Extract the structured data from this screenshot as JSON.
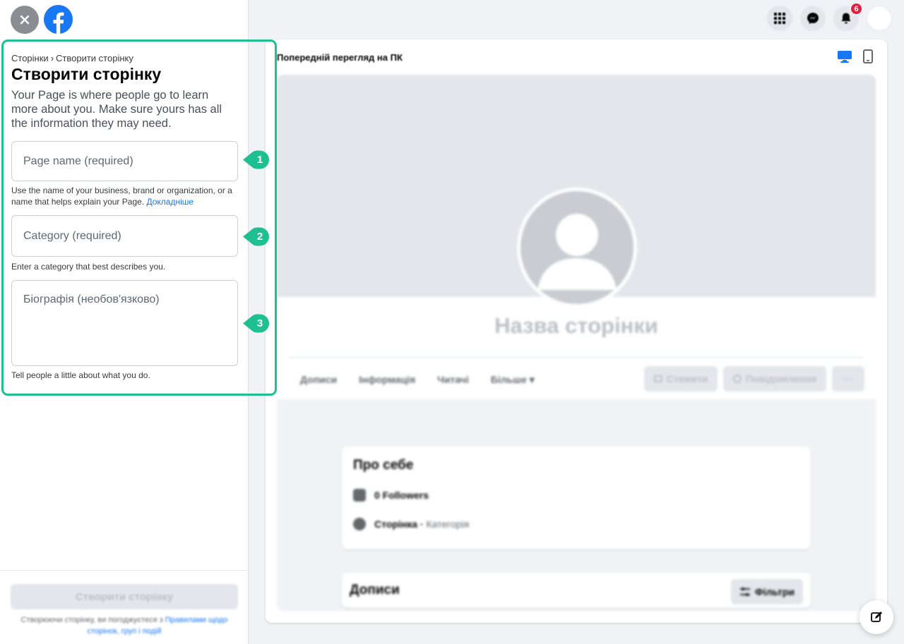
{
  "header": {
    "close_icon": "close-icon",
    "logo_icon": "facebook-logo-icon"
  },
  "breadcrumb": {
    "parent": "Сторінки",
    "separator": "›",
    "current": "Створити сторінку"
  },
  "form": {
    "title": "Створити сторінку",
    "intro": "Your Page is where people go to learn more about you. Make sure yours has all the information they may need.",
    "page_name": {
      "placeholder": "Page name (required)",
      "value": "",
      "hint": "Use the name of your business, brand or organization, or a name that helps explain your Page.",
      "hint_link": "Докладніше"
    },
    "category": {
      "placeholder": "Category (required)",
      "value": "",
      "hint": "Enter a category that best describes you."
    },
    "bio": {
      "placeholder": "Біографія (необов'язково)",
      "value": "",
      "hint": "Tell people a little about what you do."
    },
    "markers": [
      "1",
      "2",
      "3"
    ]
  },
  "footer": {
    "create_button": "Створити сторінку",
    "terms_text": "Створюючи сторінку, ви погоджуєтеся з",
    "terms_link": "Правилами щодо сторінок, груп і подій"
  },
  "topbar": {
    "notifications_badge": "6",
    "icons": [
      "menu-grid-icon",
      "messenger-icon",
      "notifications-icon",
      "account-icon"
    ]
  },
  "preview": {
    "title": "Попередній перегляд на ПК",
    "device_icons": [
      "desktop-icon",
      "mobile-icon"
    ],
    "page_name_placeholder": "Назва сторінки",
    "tabs": [
      "Дописи",
      "Інформація",
      "Читачі",
      "Більше"
    ],
    "more_caret": "▾",
    "follow_button": "Стежити",
    "message_button": "Повідомлення",
    "more_button": "···",
    "about": {
      "title": "Про себе",
      "followers": "0 Followers",
      "page_label": "Сторінка",
      "category_label": "Категорія"
    },
    "posts": {
      "title": "Дописи",
      "filters_button": "Фільтри"
    }
  },
  "colors": {
    "accent": "#1877f2",
    "highlight": "#1ec08f",
    "badge": "#e41e3f"
  }
}
